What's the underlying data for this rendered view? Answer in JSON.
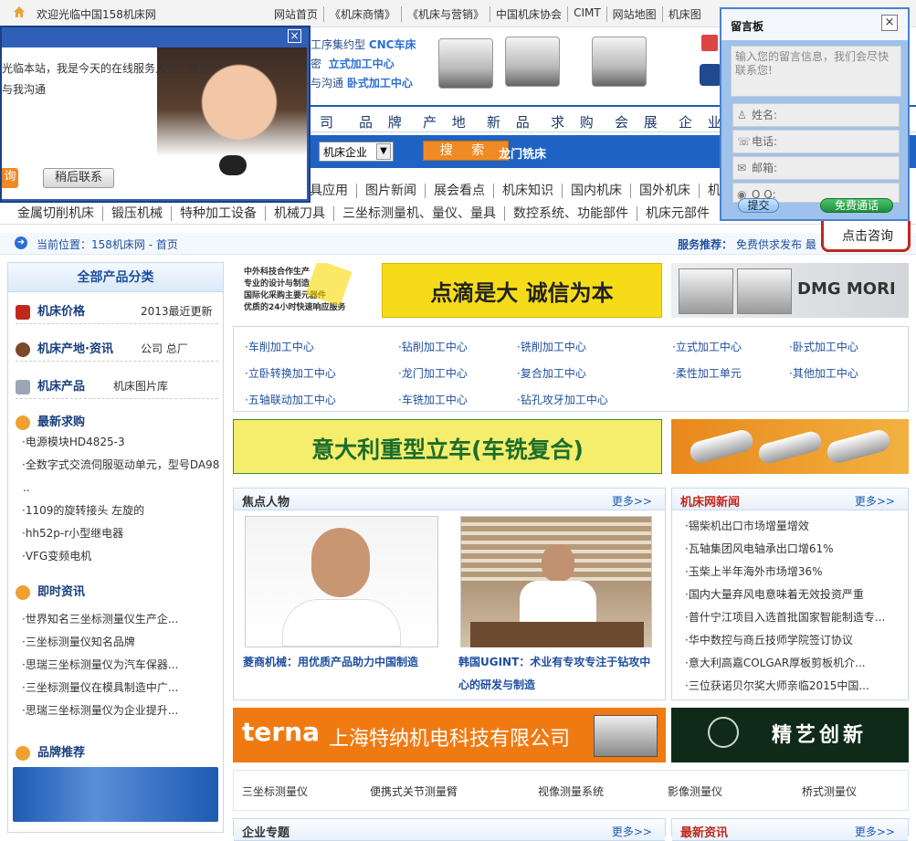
{
  "topbar": {
    "welcome": "欢迎光临中国158机床网",
    "links": [
      "网站首页",
      "《机床商情》",
      "《机床与营销》",
      "中国机床协会",
      "CIMT",
      "网站地图",
      "机床图"
    ]
  },
  "header": {
    "promo": [
      "工序集约型 CNC车床",
      "密 立式加工中心",
      "与沟通 卧式加工中心"
    ],
    "promo_tail": "CNC车床",
    "promo_v": "立式加工中心",
    "promo_h": "卧式加工中心"
  },
  "nav_main": [
    "司",
    "品 牌",
    "产 地",
    "新 品",
    "求 购",
    "会 展",
    "企 业"
  ],
  "search": {
    "select_value": "机床企业",
    "button": "搜 索",
    "hotword": "龙门铣床"
  },
  "nav_sub1": [
    "具应用",
    "图片新闻",
    "展会看点",
    "机床知识",
    "国内机床",
    "国外机床",
    "机"
  ],
  "nav_sub2": [
    "金属切削机床",
    "锻压机械",
    "特种加工设备",
    "机械刀具",
    "三坐标测量机、量仪、量具",
    "数控系统、功能部件",
    "机床元部件"
  ],
  "breadcrumb": {
    "label": "当前位置：158机床网 - 首页",
    "service_label": "服务推荐：",
    "service_text": "免费供求发布  最"
  },
  "sidebar": {
    "title": "全部产品分类",
    "sections": [
      {
        "title": "机床价格",
        "extra": "2013最近更新"
      },
      {
        "title": "机床产地·资讯",
        "extra": "公司 总厂"
      },
      {
        "title": "机床产品",
        "extra": "机床图片库"
      },
      {
        "title": "最新求购",
        "extra": ""
      },
      {
        "title": "即时资讯",
        "extra": ""
      },
      {
        "title": "品牌推荐",
        "extra": ""
      }
    ],
    "buy_list": [
      "·电源模块HD4825-3",
      "·全数字式交流伺服驱动单元，型号DA98",
      "B...",
      "·1109的旋转接头 左旋的",
      "·hh52p-r小型继电器",
      "·VFG变频电机"
    ],
    "news_list": [
      "·世界知名三坐标测量仪生产企...",
      "·三坐标测量仪知名品牌",
      "·思瑞三坐标测量仪为汽车保器...",
      "·三坐标测量仪在模具制造中广...",
      "·思瑞三坐标测量仪为企业提升..."
    ]
  },
  "banner1": {
    "left_text": "中外科技合作生产\n专业的设计与制造\n国际化采购主要元器件\n优质的24小时快速响应服务",
    "center": "点滴是大  诚信为本",
    "right": "DMG MORI"
  },
  "categories": [
    "·车削加工中心",
    "·钻削加工中心",
    "·铣削加工中心",
    "·立式加工中心",
    "·卧式加工中心",
    "·立卧转换加工中心",
    "·龙门加工中心",
    "·复合加工中心",
    "·柔性加工单元",
    "·其他加工中心",
    "·五轴联动加工中心",
    "·车铣加工中心",
    "·钻孔攻牙加工中心"
  ],
  "banner2": {
    "text": "意大利重型立车(车铣复合)"
  },
  "focus": {
    "title": "焦点人物",
    "more": "更多>>",
    "people": [
      {
        "caption": "菱商机械：用优质产品助力中国制造"
      },
      {
        "caption": "韩国UGINT：术业有专攻专注于钻攻中心的研发与制造"
      }
    ]
  },
  "news": {
    "title": "机床网新闻",
    "more": "更多>>",
    "items": [
      "·锡柴机出口市场增量增效",
      "·瓦轴集团风电轴承出口增61%",
      "·玉柴上半年海外市场增36%",
      "·国内大量弃风电意味着无效投资严重",
      "·普什宁江项目入选首批国家智能制造专...",
      "·华中数控与商丘技师学院签订协议",
      "·意大利高嘉COLGAR厚板剪板机介...",
      "·三位获诺贝尔奖大师亲临2015中国..."
    ]
  },
  "banner3": {
    "logo": "terna",
    "text": "上海特纳机电科技有限公司",
    "right": "精艺创新"
  },
  "tabs": [
    "三坐标测量仪",
    "便携式关节测量臂",
    "视像测量系统",
    "影像测量仪",
    "桥式测量仪"
  ],
  "bottom": {
    "left_title": "企业专题",
    "right_title": "最新资讯",
    "more": "更多>>"
  },
  "chat": {
    "text1": "光临本站，我是今天的在线服务人员，点击",
    "text2": "与我沟通",
    "btn_left": "询",
    "btn_right": "稍后联系"
  },
  "msgboard": {
    "title": "留言板",
    "placeholder": "输入您的留言信息，我们会尽快联系您!",
    "name": "姓名:",
    "phone": "电话:",
    "email": "邮箱:",
    "qq": "Q Q:",
    "submit": "提交",
    "call": "免费通话",
    "consult": "点击咨询"
  },
  "colors": {
    "brand_blue": "#1e63c3",
    "orange": "#f08a24",
    "red": "#c0281b",
    "yellow": "#f5e33b"
  }
}
